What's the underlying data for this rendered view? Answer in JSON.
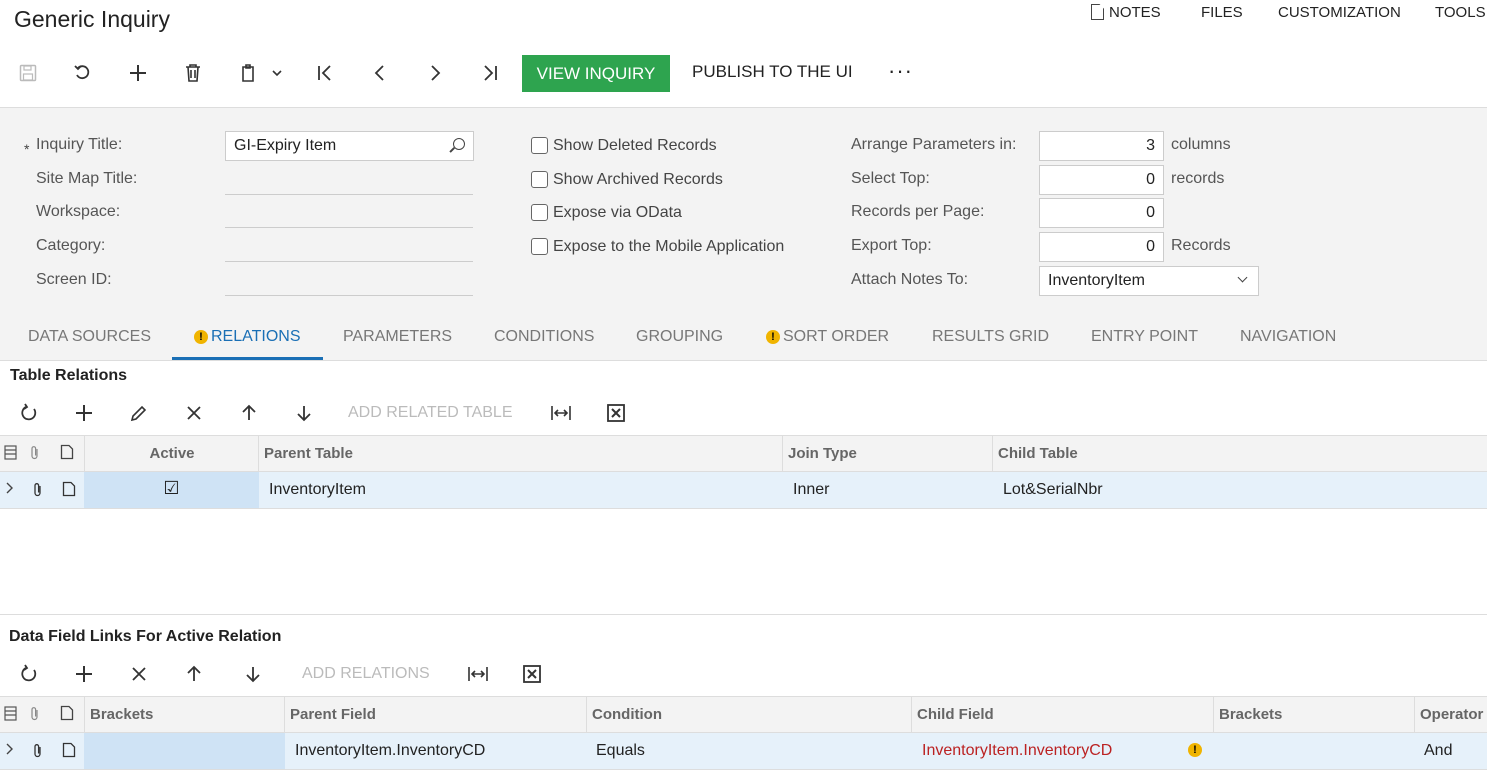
{
  "header": {
    "title": "Generic Inquiry",
    "menu": [
      "NOTES",
      "FILES",
      "CUSTOMIZATION",
      "TOOLS"
    ]
  },
  "toolbar": {
    "view_label": "VIEW INQUIRY",
    "publish_label": "PUBLISH TO THE UI",
    "more": "···"
  },
  "form": {
    "required_mark": "*",
    "inquiry_title_label": "Inquiry Title:",
    "inquiry_title_value": "GI-Expiry Item",
    "site_map_label": "Site Map Title:",
    "workspace_label": "Workspace:",
    "category_label": "Category:",
    "screen_id_label": "Screen ID:",
    "show_deleted": "Show Deleted Records",
    "show_archived": "Show Archived Records",
    "expose_odata": "Expose via OData",
    "expose_mobile": "Expose to the Mobile Application",
    "arrange_label": "Arrange Parameters in:",
    "arrange_value": "3",
    "arrange_unit": "columns",
    "select_top_label": "Select Top:",
    "select_top_value": "0",
    "select_top_unit": "records",
    "rpp_label": "Records per Page:",
    "rpp_value": "0",
    "export_top_label": "Export Top:",
    "export_top_value": "0",
    "export_top_unit": "Records",
    "attach_label": "Attach Notes To:",
    "attach_value": "InventoryItem"
  },
  "tabs": [
    "DATA SOURCES",
    "RELATIONS",
    "PARAMETERS",
    "CONDITIONS",
    "GROUPING",
    "SORT ORDER",
    "RESULTS GRID",
    "ENTRY POINT",
    "NAVIGATION"
  ],
  "table_relations": {
    "title": "Table Relations",
    "add_related": "ADD RELATED TABLE",
    "headers": [
      "Active",
      "Parent Table",
      "Join Type",
      "Child Table"
    ],
    "row": {
      "active": "☑",
      "parent": "InventoryItem",
      "join": "Inner",
      "child": "Lot&SerialNbr"
    }
  },
  "data_field_links": {
    "title": "Data Field Links For Active Relation",
    "add_relations": "ADD RELATIONS",
    "headers": [
      "Brackets",
      "Parent Field",
      "Condition",
      "Child Field",
      "Brackets",
      "Operator"
    ],
    "row": {
      "brackets": "",
      "parent_field": "InventoryItem.InventoryCD",
      "condition": "Equals",
      "child_field": "InventoryItem.InventoryCD",
      "brackets2": "",
      "operator": "And"
    }
  },
  "colors": {
    "accent": "#1a6fb5",
    "primary_button": "#2ea44f",
    "warning": "#f0b400",
    "error_text": "#b22222"
  }
}
